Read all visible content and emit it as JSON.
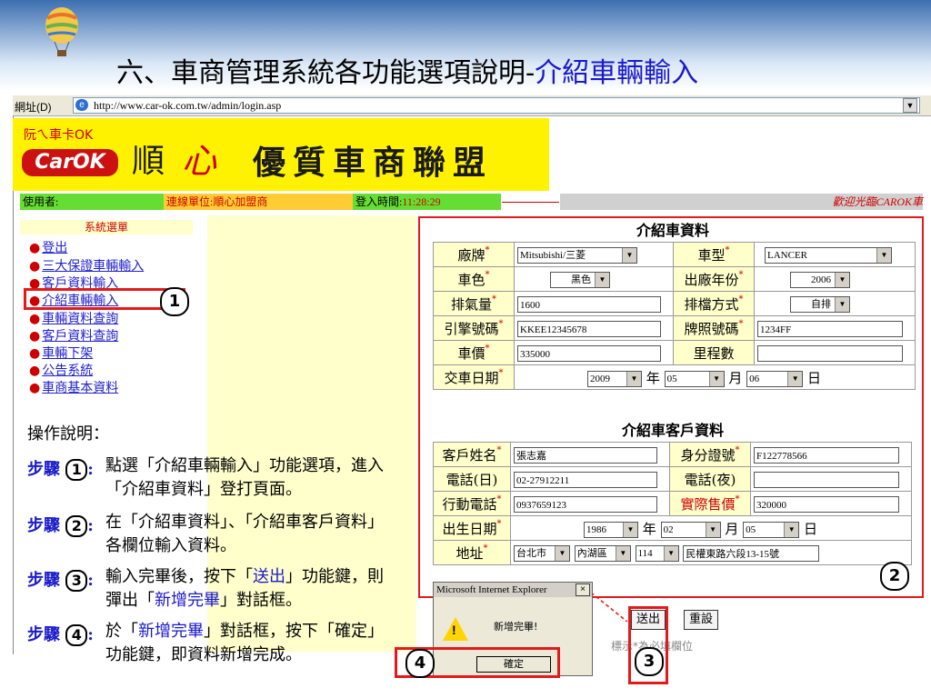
{
  "slide": {
    "title_main": "六、車商管理系統各功能選項說明-",
    "title_highlight": "介紹車輛輸入"
  },
  "browser": {
    "address_label": "網址(D)",
    "url": "http://www.car-ok.com.tw/admin/login.asp"
  },
  "banner": {
    "logo_top": "阮ㄟ車卡OK",
    "logo_word": "CarOK",
    "shun": "順",
    "xin": "心",
    "tagline": "優質車商聯盟"
  },
  "status": {
    "user_label": "使用者:",
    "unit": "連線單位:順心加盟商",
    "login_time_label": "登入時間:",
    "login_time": "11:28:29",
    "welcome": "歡迎光臨CAROK車"
  },
  "menu": {
    "header": "系統選單",
    "items": [
      "登出",
      "三大保證車輛輸入",
      "客戶資料輸入",
      "介紹車輛輸入",
      "車輛資料查詢",
      "客戶資料查詢",
      "車輛下架",
      "公告系統",
      "車商基本資料"
    ]
  },
  "instructions": {
    "title": "操作說明：",
    "step_label": "步驟",
    "steps": [
      {
        "num": "1",
        "pre": "點選「介紹車輛輸入」功能選項，進入「介紹車資料」登打頁面。",
        "hl": "",
        "post": ""
      },
      {
        "num": "2",
        "pre": "在「介紹車資料」、「介紹車客戶資料」各欄位輸入資料。",
        "hl": "",
        "post": ""
      },
      {
        "num": "3",
        "pre": " 輸入完畢後，按下「",
        "hl": "送出",
        "post": "」功能鍵，則彈出「",
        "hl2": "新增完畢",
        "post2": "」對話框。"
      },
      {
        "num": "4",
        "pre": "於「",
        "hl": "新增完畢",
        "post": "」對話框，按下「確定」功能鍵，即資料新增完成。"
      }
    ]
  },
  "vehicle": {
    "header": "介紹車資料",
    "brand_label": "廠牌",
    "brand": "Mitsubishi/三菱",
    "model_label": "車型",
    "model": "LANCER",
    "color_label": "車色",
    "color": "黑色",
    "year_label": "出廠年份",
    "year": "2006",
    "cc_label": "排氣量",
    "cc": "1600",
    "gear_label": "排檔方式",
    "gear": "自排",
    "engine_label": "引擎號碼",
    "engine": "KKEE12345678",
    "plate_label": "牌照號碼",
    "plate": "1234FF",
    "price_label": "車價",
    "price": "335000",
    "mileage_label": "里程數",
    "mileage": "",
    "delivery_label": "交車日期",
    "d_year": "2009",
    "d_month": "05",
    "d_day": "06",
    "unit_year": "年",
    "unit_month": "月",
    "unit_day": "日"
  },
  "customer": {
    "header": "介紹車客戶資料",
    "name_label": "客戶姓名",
    "name": "張志嘉",
    "id_label": "身分證號",
    "id": "F122778566",
    "tel_day_label": "電話(日)",
    "tel_day": "02-27912211",
    "tel_night_label": "電話(夜)",
    "tel_night": "",
    "mobile_label": "行動電話",
    "mobile": "0937659123",
    "actual_price_label": "實際售價",
    "actual_price": "320000",
    "birth_label": "出生日期",
    "b_year": "1986",
    "b_month": "02",
    "b_day": "05",
    "addr_label": "地址",
    "city": "台北市",
    "district": "內湖區",
    "zip": "114",
    "street": "民權東路六段13-15號"
  },
  "buttons": {
    "submit": "送出",
    "reset": "重設"
  },
  "hint": "標示*為必填欄位",
  "dialog": {
    "title": "Microsoft Internet Explorer",
    "close": "×",
    "message": "新增完畢!",
    "ok": "確定"
  },
  "markers": {
    "m1": "1",
    "m2": "2",
    "m3": "3",
    "m4": "4"
  },
  "colors": {
    "accent_red": "#e41a1a",
    "link_blue": "#2020cc",
    "banner_yellow": "#fff200"
  }
}
